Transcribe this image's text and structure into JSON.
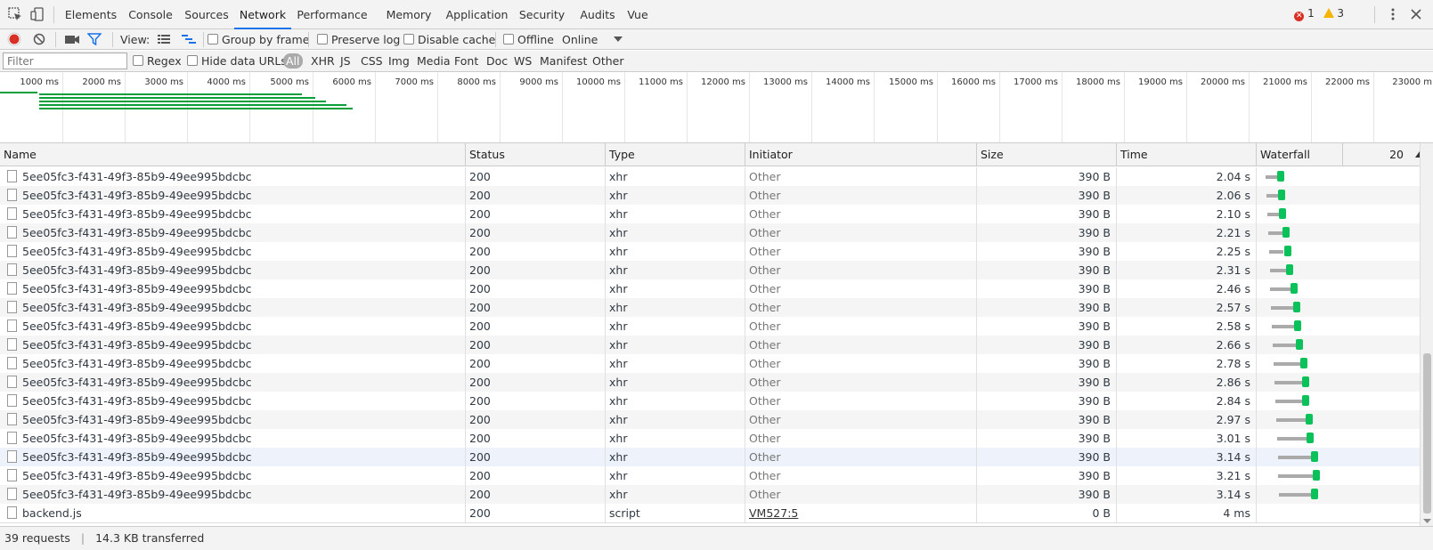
{
  "tabs": [
    "Elements",
    "Console",
    "Sources",
    "Network",
    "Performance",
    "Memory",
    "Application",
    "Security",
    "Audits",
    "Vue"
  ],
  "active_tab": "Network",
  "errors_count": "1",
  "warnings_count": "3",
  "toolbar": {
    "view_label": "View:",
    "group_by_frame": "Group by frame",
    "preserve_log": "Preserve log",
    "disable_cache": "Disable cache",
    "offline": "Offline",
    "throttling": "Online"
  },
  "filter": {
    "placeholder": "Filter",
    "regex": "Regex",
    "hide_data_urls": "Hide data URLs",
    "types": [
      "All",
      "XHR",
      "JS",
      "CSS",
      "Img",
      "Media",
      "Font",
      "Doc",
      "WS",
      "Manifest",
      "Other"
    ]
  },
  "overview_ticks": [
    "1000 ms",
    "2000 ms",
    "3000 ms",
    "4000 ms",
    "5000 ms",
    "6000 ms",
    "7000 ms",
    "8000 ms",
    "9000 ms",
    "10000 ms",
    "11000 ms",
    "12000 ms",
    "13000 ms",
    "14000 ms",
    "15000 ms",
    "16000 ms",
    "17000 ms",
    "18000 ms",
    "19000 ms",
    "20000 ms",
    "21000 ms",
    "22000 ms",
    "23000 m"
  ],
  "columns": {
    "name": "Name",
    "status": "Status",
    "type": "Type",
    "initiator": "Initiator",
    "size": "Size",
    "time": "Time",
    "waterfall": "Waterfall",
    "waterfall_scale": "20"
  },
  "rows": [
    {
      "name": "5ee05fc3-f431-49f3-85b9-49ee995bdcbc",
      "status": "200",
      "type": "xhr",
      "initiator": "Other",
      "size": "390 B",
      "time": "2.04 s"
    },
    {
      "name": "5ee05fc3-f431-49f3-85b9-49ee995bdcbc",
      "status": "200",
      "type": "xhr",
      "initiator": "Other",
      "size": "390 B",
      "time": "2.06 s"
    },
    {
      "name": "5ee05fc3-f431-49f3-85b9-49ee995bdcbc",
      "status": "200",
      "type": "xhr",
      "initiator": "Other",
      "size": "390 B",
      "time": "2.10 s"
    },
    {
      "name": "5ee05fc3-f431-49f3-85b9-49ee995bdcbc",
      "status": "200",
      "type": "xhr",
      "initiator": "Other",
      "size": "390 B",
      "time": "2.21 s"
    },
    {
      "name": "5ee05fc3-f431-49f3-85b9-49ee995bdcbc",
      "status": "200",
      "type": "xhr",
      "initiator": "Other",
      "size": "390 B",
      "time": "2.25 s"
    },
    {
      "name": "5ee05fc3-f431-49f3-85b9-49ee995bdcbc",
      "status": "200",
      "type": "xhr",
      "initiator": "Other",
      "size": "390 B",
      "time": "2.31 s"
    },
    {
      "name": "5ee05fc3-f431-49f3-85b9-49ee995bdcbc",
      "status": "200",
      "type": "xhr",
      "initiator": "Other",
      "size": "390 B",
      "time": "2.46 s"
    },
    {
      "name": "5ee05fc3-f431-49f3-85b9-49ee995bdcbc",
      "status": "200",
      "type": "xhr",
      "initiator": "Other",
      "size": "390 B",
      "time": "2.57 s"
    },
    {
      "name": "5ee05fc3-f431-49f3-85b9-49ee995bdcbc",
      "status": "200",
      "type": "xhr",
      "initiator": "Other",
      "size": "390 B",
      "time": "2.58 s"
    },
    {
      "name": "5ee05fc3-f431-49f3-85b9-49ee995bdcbc",
      "status": "200",
      "type": "xhr",
      "initiator": "Other",
      "size": "390 B",
      "time": "2.66 s"
    },
    {
      "name": "5ee05fc3-f431-49f3-85b9-49ee995bdcbc",
      "status": "200",
      "type": "xhr",
      "initiator": "Other",
      "size": "390 B",
      "time": "2.78 s"
    },
    {
      "name": "5ee05fc3-f431-49f3-85b9-49ee995bdcbc",
      "status": "200",
      "type": "xhr",
      "initiator": "Other",
      "size": "390 B",
      "time": "2.86 s"
    },
    {
      "name": "5ee05fc3-f431-49f3-85b9-49ee995bdcbc",
      "status": "200",
      "type": "xhr",
      "initiator": "Other",
      "size": "390 B",
      "time": "2.84 s"
    },
    {
      "name": "5ee05fc3-f431-49f3-85b9-49ee995bdcbc",
      "status": "200",
      "type": "xhr",
      "initiator": "Other",
      "size": "390 B",
      "time": "2.97 s"
    },
    {
      "name": "5ee05fc3-f431-49f3-85b9-49ee995bdcbc",
      "status": "200",
      "type": "xhr",
      "initiator": "Other",
      "size": "390 B",
      "time": "3.01 s"
    },
    {
      "name": "5ee05fc3-f431-49f3-85b9-49ee995bdcbc",
      "status": "200",
      "type": "xhr",
      "initiator": "Other",
      "size": "390 B",
      "time": "3.14 s"
    },
    {
      "name": "5ee05fc3-f431-49f3-85b9-49ee995bdcbc",
      "status": "200",
      "type": "xhr",
      "initiator": "Other",
      "size": "390 B",
      "time": "3.21 s"
    },
    {
      "name": "5ee05fc3-f431-49f3-85b9-49ee995bdcbc",
      "status": "200",
      "type": "xhr",
      "initiator": "Other",
      "size": "390 B",
      "time": "3.14 s"
    },
    {
      "name": "backend.js",
      "status": "200",
      "type": "script",
      "initiator": "VM527:5",
      "size": "0 B",
      "time": "4 ms"
    }
  ],
  "footer": {
    "requests": "39 requests",
    "transferred": "14.3 KB transferred"
  },
  "colors": {
    "accent": "#1a73e8",
    "record": "#d93025",
    "waterfall_receive": "#0ac15a",
    "overview_bar": "#0a9f3b"
  }
}
